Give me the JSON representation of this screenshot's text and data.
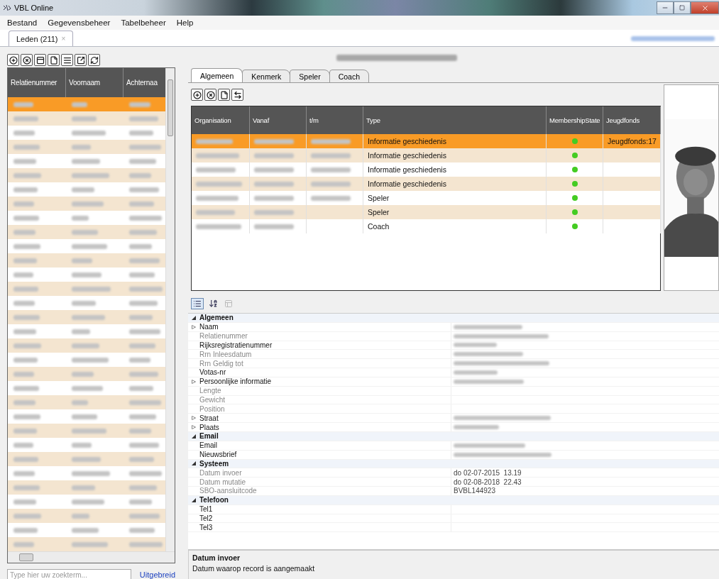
{
  "window": {
    "title": "VBL Online"
  },
  "menu": [
    "Bestand",
    "Gegevensbeheer",
    "Tabelbeheer",
    "Help"
  ],
  "doc_tabs": [
    {
      "label": "Leden (211)",
      "close": "×",
      "selected": true
    }
  ],
  "members": {
    "columns": [
      "Relatienummer",
      "Voornaam",
      "Achternaa"
    ],
    "rows": [
      {
        "selected": true
      },
      {
        "selected": false
      },
      {
        "selected": false
      },
      {
        "selected": false
      },
      {
        "selected": false
      },
      {
        "selected": false
      },
      {
        "selected": false
      },
      {
        "selected": false
      },
      {
        "selected": false
      },
      {
        "selected": false
      },
      {
        "selected": false
      },
      {
        "selected": false
      },
      {
        "selected": false
      },
      {
        "selected": false
      },
      {
        "selected": false
      },
      {
        "selected": false
      },
      {
        "selected": false
      },
      {
        "selected": false
      },
      {
        "selected": false
      },
      {
        "selected": false
      },
      {
        "selected": false
      },
      {
        "selected": false
      },
      {
        "selected": false
      },
      {
        "selected": false
      },
      {
        "selected": false
      },
      {
        "selected": false
      },
      {
        "selected": false
      },
      {
        "selected": false
      },
      {
        "selected": false
      },
      {
        "selected": false
      },
      {
        "selected": false
      },
      {
        "selected": false
      }
    ]
  },
  "search": {
    "placeholder": "Type hier uw zoekterm...",
    "link": "Uitgebreid"
  },
  "detail_tabs": [
    {
      "label": "Algemeen",
      "selected": true
    },
    {
      "label": "Kenmerk",
      "selected": false
    },
    {
      "label": "Speler",
      "selected": false
    },
    {
      "label": "Coach",
      "selected": false
    }
  ],
  "memberships": {
    "columns": [
      "Organisation",
      "Vanaf",
      "t/m",
      "Type",
      "MembershipState",
      "Jeugdfonds"
    ],
    "rows": [
      {
        "selected": true,
        "tm_redacted": true,
        "type": "Informatie geschiedenis",
        "color": "#44cc22",
        "jeugdfonds": "Jeugdfonds:17"
      },
      {
        "selected": false,
        "tm_redacted": true,
        "type": "Informatie geschiedenis",
        "color": "#44cc22"
      },
      {
        "selected": false,
        "tm_redacted": true,
        "type": "Informatie geschiedenis",
        "color": "#44cc22"
      },
      {
        "selected": false,
        "tm_redacted": true,
        "type": "Informatie geschiedenis",
        "color": "#44cc22"
      },
      {
        "selected": false,
        "tm_redacted": true,
        "type": "Speler",
        "color": "#44cc22"
      },
      {
        "selected": false,
        "tm_redacted": false,
        "type": "Speler",
        "color": "#44cc22"
      },
      {
        "selected": false,
        "tm_redacted": false,
        "type": "Coach",
        "color": "#44cc22"
      }
    ]
  },
  "properties": [
    {
      "label": "Algemeen",
      "expanded": true,
      "items": [
        {
          "label": "Naam",
          "collapsed": true,
          "readonly": false,
          "redacted": true
        },
        {
          "label": "Relatienummer",
          "collapsed": false,
          "readonly": true,
          "redacted": true
        },
        {
          "label": "Rijksregistratienummer",
          "collapsed": false,
          "readonly": false,
          "redacted": true
        },
        {
          "label": "Rrn Inleesdatum",
          "collapsed": false,
          "readonly": true,
          "redacted": true
        },
        {
          "label": "Rrn Geldig tot",
          "collapsed": false,
          "readonly": true,
          "redacted": true
        },
        {
          "label": "Votas-nr",
          "collapsed": false,
          "readonly": false,
          "redacted": true
        },
        {
          "label": "Persoonlijke informatie",
          "collapsed": true,
          "readonly": false,
          "redacted": true
        },
        {
          "label": "Lengte",
          "collapsed": false,
          "readonly": true,
          "redacted": false
        },
        {
          "label": "Gewicht",
          "collapsed": false,
          "readonly": true,
          "redacted": false
        },
        {
          "label": "Position",
          "collapsed": false,
          "readonly": true,
          "redacted": false
        },
        {
          "label": "Straat",
          "collapsed": true,
          "readonly": false,
          "redacted": true
        },
        {
          "label": "Plaats",
          "collapsed": true,
          "readonly": false,
          "redacted": true
        }
      ]
    },
    {
      "label": "Email",
      "expanded": true,
      "items": [
        {
          "label": "Email",
          "collapsed": false,
          "readonly": false,
          "redacted": true
        },
        {
          "label": "Nieuwsbrief",
          "collapsed": false,
          "readonly": false,
          "redacted": true
        }
      ]
    },
    {
      "label": "Systeem",
      "expanded": true,
      "items": [
        {
          "label": "Datum invoer",
          "collapsed": false,
          "readonly": true,
          "redacted": false,
          "value": "do 02-07-2015  13.19"
        },
        {
          "label": "Datum mutatie",
          "collapsed": false,
          "readonly": true,
          "redacted": false,
          "value": "do 02-08-2018  22.43"
        },
        {
          "label": "SBO-aansluitcode",
          "collapsed": false,
          "readonly": true,
          "redacted": false,
          "value": "BVBL144923"
        }
      ]
    },
    {
      "label": "Telefoon",
      "expanded": true,
      "items": [
        {
          "label": "Tel1",
          "collapsed": false,
          "readonly": false,
          "redacted": false
        },
        {
          "label": "Tel2",
          "collapsed": false,
          "readonly": false,
          "redacted": false
        },
        {
          "label": "Tel3",
          "collapsed": false,
          "readonly": false,
          "redacted": false
        }
      ]
    }
  ],
  "description": {
    "title": "Datum invoer",
    "text": "Datum waarop record is aangemaakt"
  }
}
